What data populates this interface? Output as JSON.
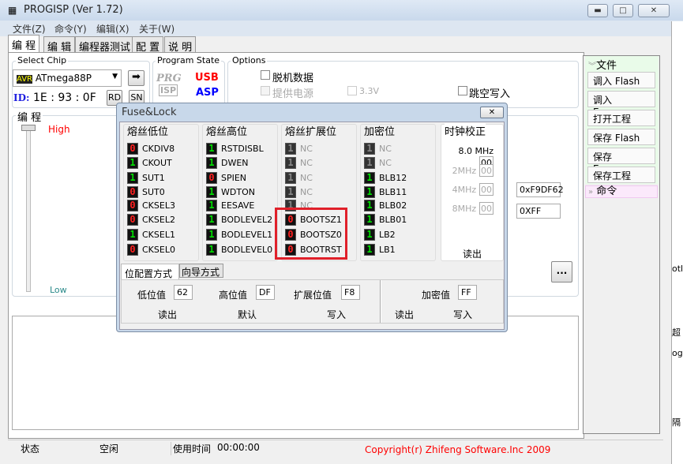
{
  "window": {
    "title": "PROGISP (Ver 1.72)",
    "min": "▬",
    "max": "□",
    "close": "✕"
  },
  "menu": [
    "文件(Z)",
    "命令(Y)",
    "编辑(X)",
    "关于(W)"
  ],
  "tabs": [
    "编 程",
    "编 辑",
    "编程器测试",
    "配 置",
    "说 明"
  ],
  "chip": {
    "group": "Select Chip",
    "value": "ATmega88P",
    "id_label": "ID:",
    "id_value": "1E : 93 : 0F",
    "rd": "RD",
    "sn": "SN"
  },
  "program_state": {
    "group": "Program State",
    "prg": "PRG",
    "isp": "ISP",
    "usb": "USB",
    "asp": "ASP"
  },
  "options": {
    "group": "Options",
    "offline": "脱机数据",
    "power": "提供电源",
    "voltage": "3.3V",
    "skip": "跳空写入"
  },
  "prog_group": {
    "label": "编 程",
    "high": "High",
    "low": "Low"
  },
  "fields": {
    "fuse": "0xF9DF62",
    "lock": "0XFF",
    "more": "..."
  },
  "side": {
    "file_header": "文件",
    "items": [
      "调入 Flash",
      "调入 Eeprom",
      "打开工程",
      "保存 Flash",
      "保存 Eeprom",
      "保存工程"
    ],
    "cmd_header": "命令"
  },
  "status": {
    "state_label": "状态",
    "state": "空闲",
    "time_label": "使用时间",
    "time": "00:00:00",
    "copyright": "Copyright(r) Zhifeng Software.Inc 2009"
  },
  "right_edge": [
    "otlo",
    "超",
    "og",
    "隔"
  ],
  "fuse_dialog": {
    "title": "Fuse&Lock",
    "close": "✕",
    "columns": [
      {
        "title": "熔丝低位",
        "bits": [
          {
            "name": "CKDIV8",
            "v": "0"
          },
          {
            "name": "CKOUT",
            "v": "1"
          },
          {
            "name": "SUT1",
            "v": "1"
          },
          {
            "name": "SUT0",
            "v": "0"
          },
          {
            "name": "CKSEL3",
            "v": "0"
          },
          {
            "name": "CKSEL2",
            "v": "0"
          },
          {
            "name": "CKSEL1",
            "v": "1"
          },
          {
            "name": "CKSEL0",
            "v": "0"
          }
        ]
      },
      {
        "title": "熔丝高位",
        "bits": [
          {
            "name": "RSTDISBL",
            "v": "1"
          },
          {
            "name": "DWEN",
            "v": "1"
          },
          {
            "name": "SPIEN",
            "v": "0"
          },
          {
            "name": "WDTON",
            "v": "1"
          },
          {
            "name": "EESAVE",
            "v": "1"
          },
          {
            "name": "BODLEVEL2",
            "v": "1"
          },
          {
            "name": "BODLEVEL1",
            "v": "1"
          },
          {
            "name": "BODLEVEL0",
            "v": "1"
          }
        ]
      },
      {
        "title": "熔丝扩展位",
        "bits": [
          {
            "name": "NC",
            "v": "1",
            "disabled": true
          },
          {
            "name": "NC",
            "v": "1",
            "disabled": true
          },
          {
            "name": "NC",
            "v": "1",
            "disabled": true
          },
          {
            "name": "NC",
            "v": "1",
            "disabled": true
          },
          {
            "name": "NC",
            "v": "1",
            "disabled": true
          },
          {
            "name": "BOOTSZ1",
            "v": "0"
          },
          {
            "name": "BOOTSZ0",
            "v": "0"
          },
          {
            "name": "BOOTRST",
            "v": "0"
          }
        ]
      },
      {
        "title": "加密位",
        "bits": [
          {
            "name": "NC",
            "v": "1",
            "disabled": true
          },
          {
            "name": "NC",
            "v": "1",
            "disabled": true
          },
          {
            "name": "BLB12",
            "v": "1"
          },
          {
            "name": "BLB11",
            "v": "1"
          },
          {
            "name": "BLB02",
            "v": "1"
          },
          {
            "name": "BLB01",
            "v": "1"
          },
          {
            "name": "LB2",
            "v": "1"
          },
          {
            "name": "LB1",
            "v": "1"
          }
        ]
      }
    ],
    "highlight_color": "#e0202a",
    "one_color": "#00e000",
    "zero_color": "#ff2020",
    "clock": {
      "title": "时钟校正",
      "rows": [
        {
          "label": "8.0 MHz",
          "v": "00"
        },
        {
          "label": "2MHz",
          "v": "00"
        },
        {
          "label": "4MHz",
          "v": "00"
        },
        {
          "label": "8MHz",
          "v": "00"
        }
      ],
      "read": "读出"
    },
    "subtabs": [
      "位配置方式",
      "向导方式"
    ],
    "low_label": "低位值",
    "low": "62",
    "high_label": "高位值",
    "high": "DF",
    "ext_label": "扩展位值",
    "ext": "F8",
    "lock_label": "加密值",
    "lock": "FF",
    "read": "读出",
    "default": "默认",
    "write": "写入",
    "lock_read": "读出",
    "lock_write": "写入"
  }
}
